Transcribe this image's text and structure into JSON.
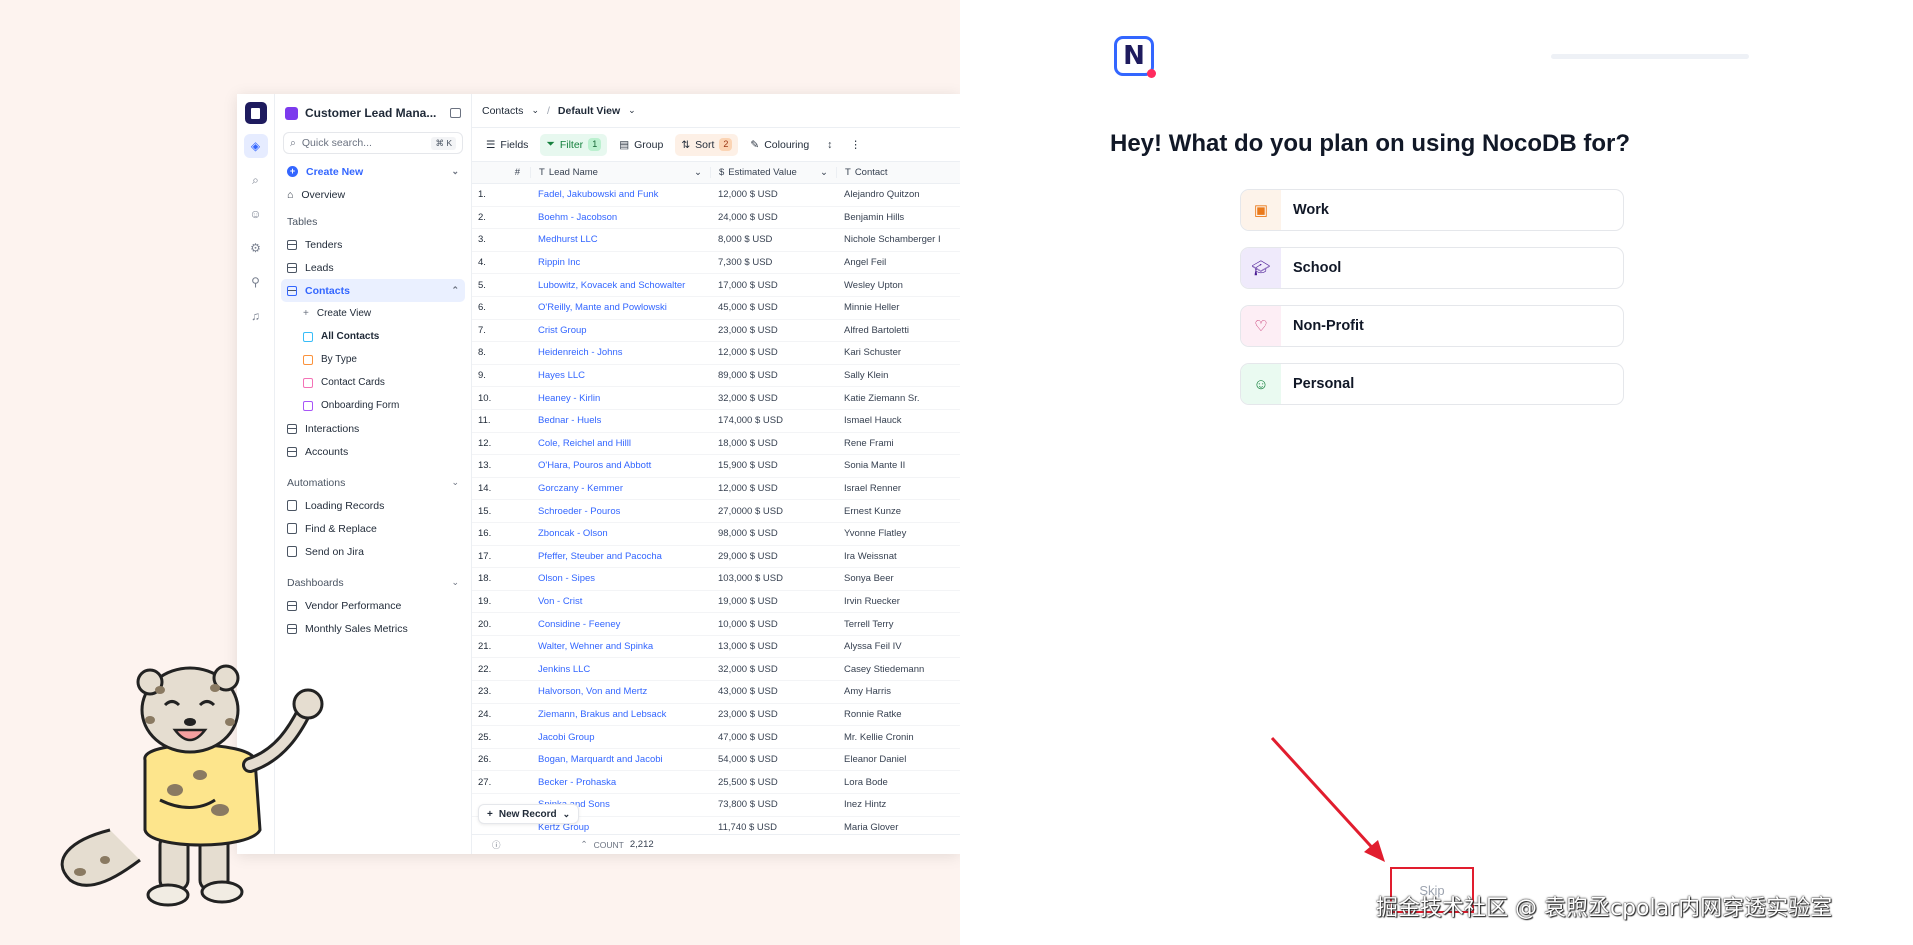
{
  "app": {
    "workspace": "Customer Lead Mana...",
    "search_placeholder": "Quick search...",
    "search_kbd": "⌘ K",
    "create_new": "Create New",
    "overview": "Overview",
    "tables_section": "Tables",
    "tables": [
      "Tenders",
      "Leads",
      "Contacts"
    ],
    "views": [
      {
        "label": "Create View",
        "color": ""
      },
      {
        "label": "All Contacts",
        "color": "#38bdf8"
      },
      {
        "label": "By Type",
        "color": "#fb923c"
      },
      {
        "label": "Contact Cards",
        "color": "#f472b6"
      },
      {
        "label": "Onboarding Form",
        "color": "#a855f7"
      }
    ],
    "more_tables": [
      "Interactions",
      "Accounts"
    ],
    "automations_section": "Automations",
    "automations": [
      "Loading Records",
      "Find & Replace",
      "Send on Jira"
    ],
    "dashboards_section": "Dashboards",
    "dashboards": [
      "Vendor Performance",
      "Monthly Sales Metrics"
    ]
  },
  "grid": {
    "breadcrumb_table": "Contacts",
    "breadcrumb_sep": "/",
    "breadcrumb_view": "Default View",
    "toolbar": {
      "fields": "Fields",
      "filter": "Filter",
      "filter_count": "1",
      "group": "Group",
      "sort": "Sort",
      "sort_count": "2",
      "colouring": "Colouring"
    },
    "columns": {
      "num": "#",
      "lead": "Lead Name",
      "est": "Estimated Value",
      "contact": "Contact"
    },
    "rows": [
      {
        "n": "1.",
        "lead": "Fadel, Jakubowski and Funk",
        "est": "12,000  $  USD",
        "contact": "Alejandro Quitzon"
      },
      {
        "n": "2.",
        "lead": "Boehm - Jacobson",
        "est": "24,000  $  USD",
        "contact": "Benjamin Hills"
      },
      {
        "n": "3.",
        "lead": "Medhurst LLC",
        "est": "8,000  $  USD",
        "contact": "Nichole Schamberger I"
      },
      {
        "n": "4.",
        "lead": "Rippin Inc",
        "est": "7,300  $  USD",
        "contact": "Angel Feil"
      },
      {
        "n": "5.",
        "lead": "Lubowitz, Kovacek and Schowalter",
        "est": "17,000  $  USD",
        "contact": "Wesley Upton"
      },
      {
        "n": "6.",
        "lead": "O'Reilly, Mante and Powlowski",
        "est": "45,000  $  USD",
        "contact": "Minnie Heller"
      },
      {
        "n": "7.",
        "lead": "Crist Group",
        "est": "23,000  $  USD",
        "contact": "Alfred Bartoletti"
      },
      {
        "n": "8.",
        "lead": "Heidenreich - Johns",
        "est": "12,000  $  USD",
        "contact": "Kari Schuster"
      },
      {
        "n": "9.",
        "lead": "Hayes LLC",
        "est": "89,000  $  USD",
        "contact": "Sally Klein"
      },
      {
        "n": "10.",
        "lead": "Heaney - Kirlin",
        "est": "32,000  $  USD",
        "contact": "Katie Ziemann Sr."
      },
      {
        "n": "11.",
        "lead": "Bednar - Huels",
        "est": "174,000  $  USD",
        "contact": "Ismael Hauck"
      },
      {
        "n": "12.",
        "lead": "Cole, Reichel and Hilll",
        "est": "18,000  $  USD",
        "contact": "Rene Frami"
      },
      {
        "n": "13.",
        "lead": "O'Hara, Pouros and Abbott",
        "est": "15,900  $  USD",
        "contact": "Sonia Mante II"
      },
      {
        "n": "14.",
        "lead": "Gorczany - Kemmer",
        "est": "12,000  $  USD",
        "contact": "Israel Renner"
      },
      {
        "n": "15.",
        "lead": "Schroeder - Pouros",
        "est": "27,0000  $  USD",
        "contact": "Ernest Kunze"
      },
      {
        "n": "16.",
        "lead": "Zboncak - Olson",
        "est": "98,000  $  USD",
        "contact": "Yvonne Flatley"
      },
      {
        "n": "17.",
        "lead": "Pfeffer, Steuber and Pacocha",
        "est": "29,000  $  USD",
        "contact": "Ira Weissnat"
      },
      {
        "n": "18.",
        "lead": "Olson - Sipes",
        "est": "103,000  $  USD",
        "contact": "Sonya Beer"
      },
      {
        "n": "19.",
        "lead": "Von - Crist",
        "est": "19,000  $  USD",
        "contact": "Irvin Ruecker"
      },
      {
        "n": "20.",
        "lead": "Considine - Feeney",
        "est": "10,000  $  USD",
        "contact": "Terrell Terry"
      },
      {
        "n": "21.",
        "lead": "Walter, Wehner and Spinka",
        "est": "13,000  $  USD",
        "contact": "Alyssa Feil IV"
      },
      {
        "n": "22.",
        "lead": "Jenkins LLC",
        "est": "32,000  $  USD",
        "contact": "Casey Stiedemann"
      },
      {
        "n": "23.",
        "lead": "Halvorson, Von and Mertz",
        "est": "43,000  $  USD",
        "contact": "Amy Harris"
      },
      {
        "n": "24.",
        "lead": "Ziemann, Brakus and Lebsack",
        "est": "23,000  $  USD",
        "contact": "Ronnie Ratke"
      },
      {
        "n": "25.",
        "lead": "Jacobi Group",
        "est": "47,000  $  USD",
        "contact": "Mr. Kellie Cronin"
      },
      {
        "n": "26.",
        "lead": "Bogan, Marquardt and Jacobi",
        "est": "54,000  $  USD",
        "contact": "Eleanor Daniel"
      },
      {
        "n": "27.",
        "lead": "Becker - Prohaska",
        "est": "25,500  $  USD",
        "contact": "Lora Bode"
      },
      {
        "n": "",
        "lead": "Spinka and Sons",
        "est": "73,800  $  USD",
        "contact": "Inez Hintz"
      },
      {
        "n": "",
        "lead": "Kertz Group",
        "est": "11,740  $  USD",
        "contact": "Maria Glover"
      }
    ],
    "new_record": "New Record",
    "count_label": "COUNT",
    "count_value": "2,212"
  },
  "onboarding": {
    "logo_letter": "N",
    "question": "Hey! What do you plan on using NocoDB for?",
    "options": [
      {
        "label": "Work",
        "icon": "briefcase-icon",
        "bg": "#fdf3ea",
        "color": "#ea7a1c"
      },
      {
        "label": "School",
        "icon": "graduation-cap-icon",
        "bg": "#efeafb",
        "color": "#4c1d95"
      },
      {
        "label": "Non-Profit",
        "icon": "heart-icon",
        "bg": "#fdeef5",
        "color": "#be185d"
      },
      {
        "label": "Personal",
        "icon": "user-icon",
        "bg": "#eafaf1",
        "color": "#15803d"
      }
    ],
    "skip": "Skip",
    "watermark": "掘金技术社区 @ 袁煦丞cpolar内网穿透实验室"
  }
}
